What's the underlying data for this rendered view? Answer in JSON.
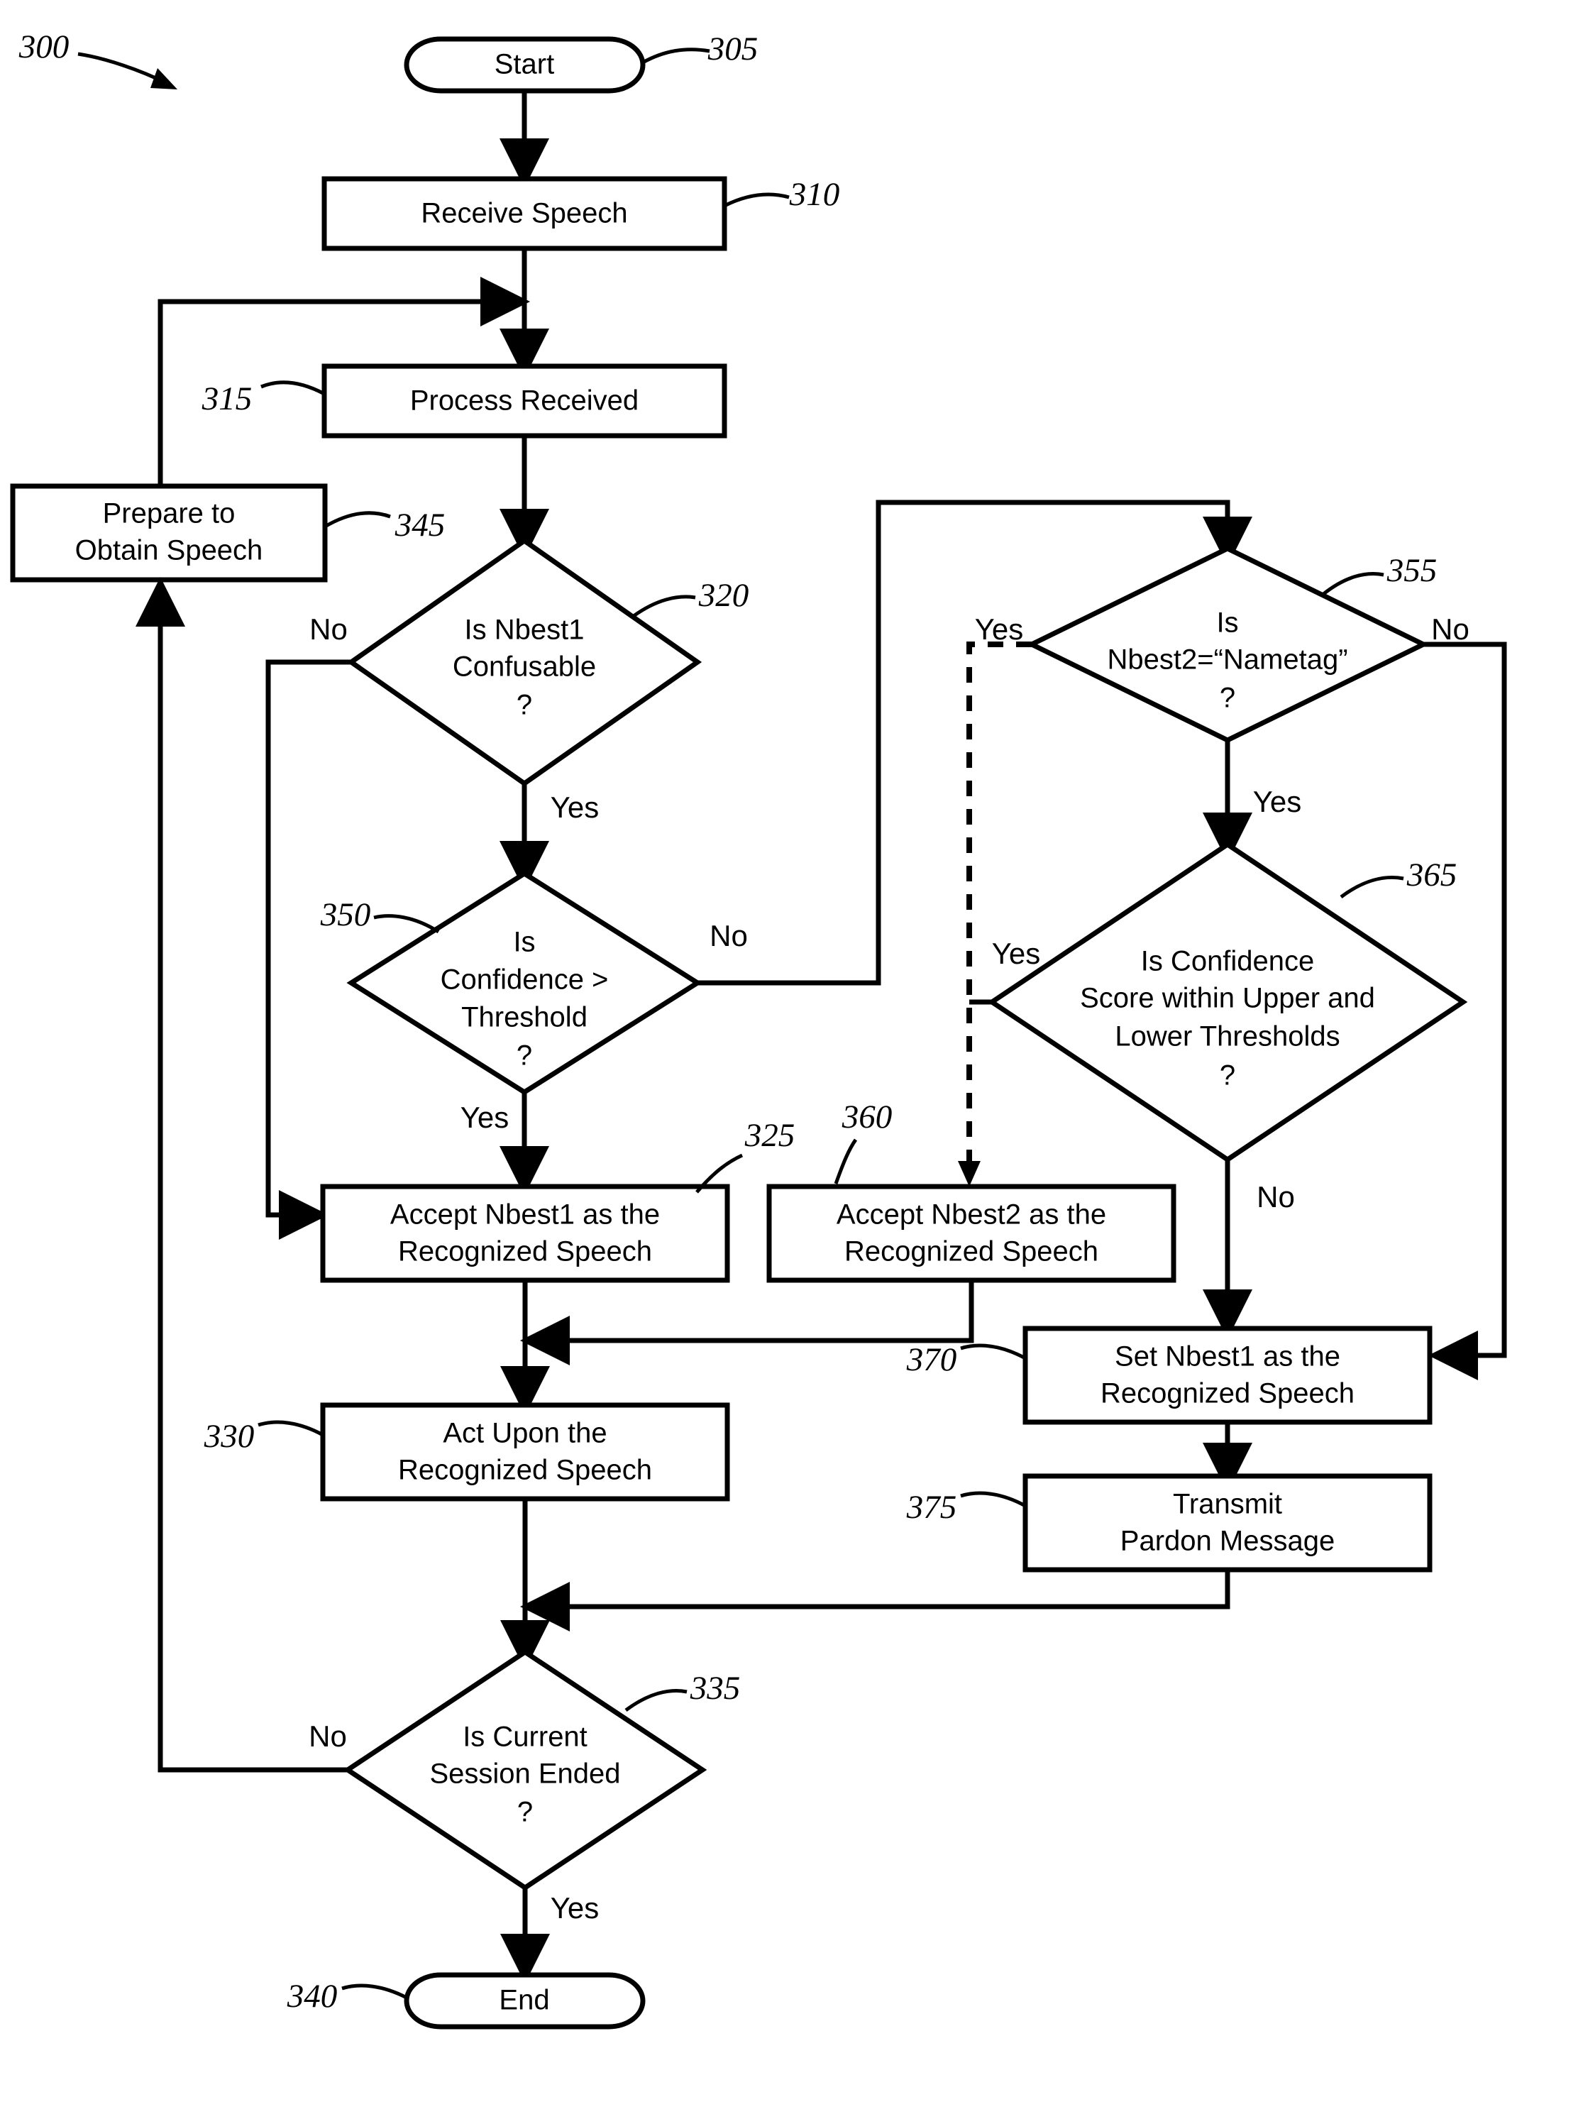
{
  "figure": {
    "figure_ref": "300",
    "type": "flowchart"
  },
  "nodes": {
    "start": {
      "ref": "305",
      "label": "Start",
      "shape": "terminator"
    },
    "receive_speech": {
      "ref": "310",
      "label": "Receive Speech",
      "shape": "process"
    },
    "process_received": {
      "ref": "315",
      "label": "Process Received",
      "shape": "process"
    },
    "prepare_obtain": {
      "ref": "345",
      "label_line1": "Prepare to",
      "label_line2": "Obtain Speech",
      "shape": "process"
    },
    "nbest1_confusable": {
      "ref": "320",
      "label_line1": "Is Nbest1",
      "label_line2": "Confusable",
      "label_line3": "?",
      "shape": "decision"
    },
    "confidence_threshold": {
      "ref": "350",
      "label_line1": "Is",
      "label_line2": "Confidence >",
      "label_line3": "Threshold",
      "label_line4": "?",
      "shape": "decision"
    },
    "nbest2_nametag": {
      "ref": "355",
      "label_line1": "Is",
      "label_line2": "Nbest2=“Nametag”",
      "label_line3": "?",
      "shape": "decision"
    },
    "confidence_within": {
      "ref": "365",
      "label_line1": "Is Confidence",
      "label_line2": "Score within Upper and",
      "label_line3": "Lower Thresholds",
      "label_line4": "?",
      "shape": "decision"
    },
    "accept_nbest1": {
      "ref": "325",
      "label_line1": "Accept Nbest1 as the",
      "label_line2": "Recognized Speech",
      "shape": "process"
    },
    "accept_nbest2": {
      "ref": "360",
      "label_line1": "Accept Nbest2 as the",
      "label_line2": "Recognized Speech",
      "shape": "process"
    },
    "set_nbest1": {
      "ref": "370",
      "label_line1": "Set Nbest1 as the",
      "label_line2": "Recognized Speech",
      "shape": "process"
    },
    "transmit_pardon": {
      "ref": "375",
      "label_line1": "Transmit",
      "label_line2": "Pardon Message",
      "shape": "process"
    },
    "act_upon": {
      "ref": "330",
      "label_line1": "Act Upon the",
      "label_line2": "Recognized Speech",
      "shape": "process"
    },
    "session_ended": {
      "ref": "335",
      "label_line1": "Is Current",
      "label_line2": "Session Ended",
      "label_line3": "?",
      "shape": "decision"
    },
    "end": {
      "ref": "340",
      "label": "End",
      "shape": "terminator"
    }
  },
  "branch_labels": {
    "confusable_no": "No",
    "confusable_yes": "Yes",
    "threshold_no": "No",
    "threshold_yes": "Yes",
    "nametag_yes": "Yes",
    "nametag_no": "No",
    "nametag_down_yes": "Yes",
    "within_yes": "Yes",
    "within_no": "No",
    "session_no": "No",
    "session_yes": "Yes"
  },
  "colors": {
    "stroke": "#000000",
    "fill": "#ffffff",
    "text": "#000000"
  }
}
